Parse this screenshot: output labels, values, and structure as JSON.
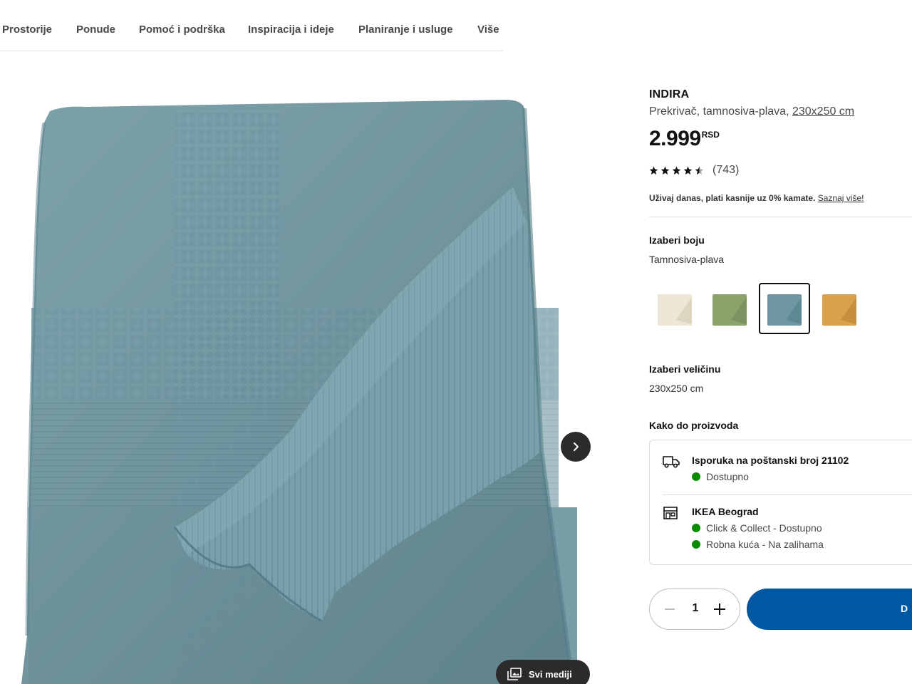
{
  "nav": {
    "items": [
      "Prostorije",
      "Ponude",
      "Pomoć i podrška",
      "Inspiracija i ideje",
      "Planiranje i usluge",
      "Više"
    ]
  },
  "gallery": {
    "media_button_label": "Svi mediji",
    "next_icon": "chevron-right-icon"
  },
  "product": {
    "name": "INDIRA",
    "description": "Prekrivač, tamnosiva-plava, ",
    "size_link": "230x250 cm",
    "price": "2.999",
    "currency": "RSD",
    "rating_count": "(743)",
    "rating_stars": 4.5,
    "finance_text": "Uživaj danas, plati kasnije uz 0% kamate. ",
    "finance_link": "Saznaj više!"
  },
  "color": {
    "title": "Izaberi boju",
    "selected_name": "Tamnosiva-plava",
    "swatches": [
      {
        "color": "#ece6d6",
        "selected": false
      },
      {
        "color": "#8aa36a",
        "selected": false
      },
      {
        "color": "#6f97a1",
        "selected": true
      },
      {
        "color": "#d9a14a",
        "selected": false
      }
    ]
  },
  "size": {
    "title": "Izaberi veličinu",
    "value": "230x250 cm"
  },
  "availability": {
    "title": "Kako do proizvoda",
    "delivery": {
      "title": "Isporuka na poštanski broj 21102",
      "status": "Dostupno"
    },
    "store": {
      "title": "IKEA Beograd",
      "statuses": [
        "Click & Collect - Dostupno",
        "Robna kuća - Na zalihama"
      ]
    }
  },
  "cart": {
    "quantity": "1",
    "add_label": "D"
  },
  "colors": {
    "accent": "#0058a3",
    "available": "#0a8a00",
    "blanket": "#6f97a1"
  }
}
